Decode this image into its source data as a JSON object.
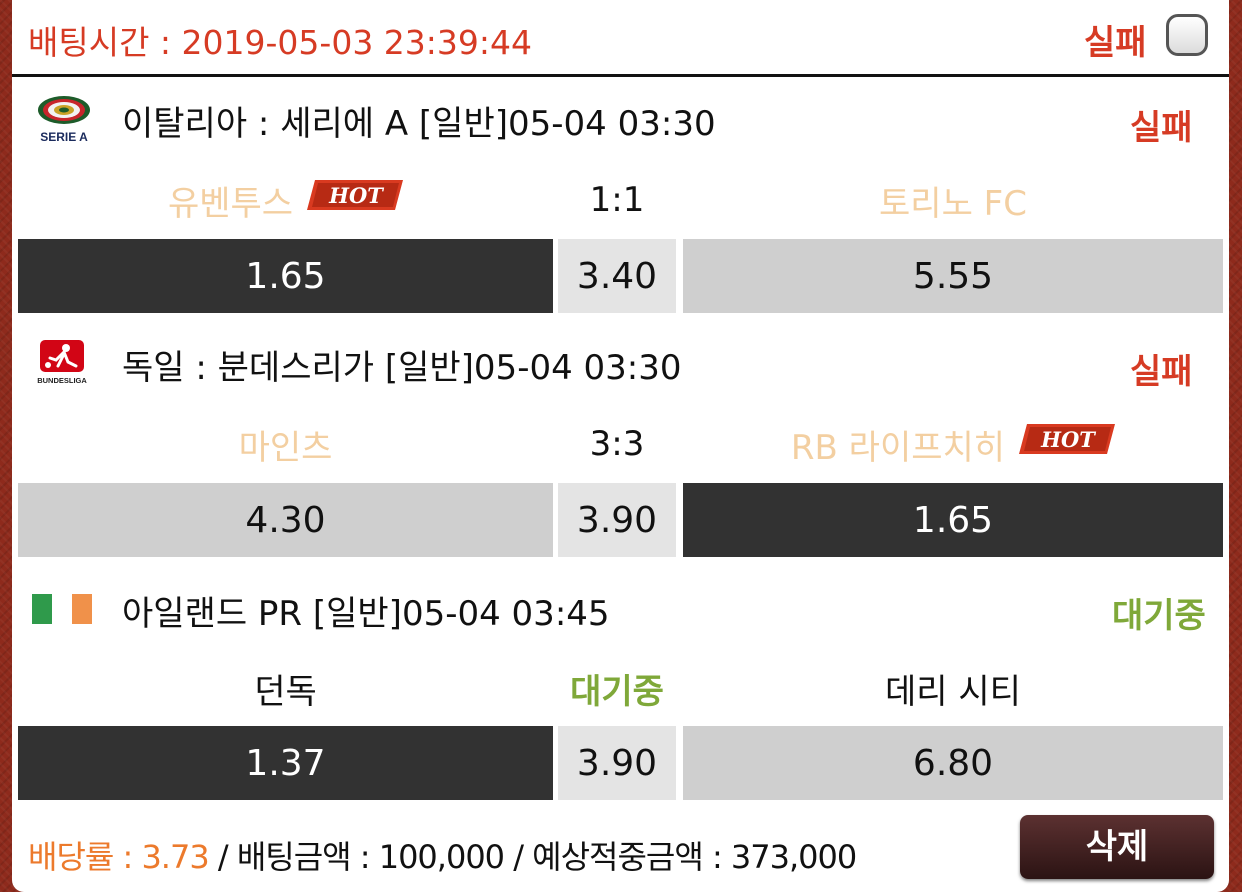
{
  "header": {
    "bet_time": "배팅시간 : 2019-05-03 23:39:44",
    "status": "실패"
  },
  "hot_badge": "HOT",
  "colors": {
    "accent_red": "#d63b24",
    "pending_green": "#7fa839",
    "rate_orange": "#ec7a2c",
    "selected_odd": "#323232",
    "unselected_odd": "#cfcfcf"
  },
  "matches": [
    {
      "league_icon": "serie-a-logo",
      "league_logo_text": "SERIE A",
      "title": "이탈리아 : 세리에 A [일반]05-04 03:30",
      "status": "실패",
      "home": "유벤투스",
      "score": "1:1",
      "away": "토리노 FC",
      "odds": {
        "home": "1.65",
        "draw": "3.40",
        "away": "5.55"
      },
      "selected": "home",
      "hot": "home"
    },
    {
      "league_icon": "bundesliga-logo",
      "league_logo_text": "BUNDESLIGA",
      "title": "독일 : 분데스리가 [일반]05-04 03:30",
      "status": "실패",
      "home": "마인츠",
      "score": "3:3",
      "away": "RB 라이프치히",
      "odds": {
        "home": "4.30",
        "draw": "3.90",
        "away": "1.65"
      },
      "selected": "away",
      "hot": "away"
    },
    {
      "league_icon": "ireland-flag-icon",
      "title": "아일랜드 PR [일반]05-04 03:45",
      "status": "대기중",
      "home": "던독",
      "score": "대기중",
      "away": "데리 시티",
      "odds": {
        "home": "1.37",
        "draw": "3.90",
        "away": "6.80"
      },
      "selected": "home"
    }
  ],
  "footer": {
    "rate_label": "배당률 : 3.73",
    "amount_label": " / 배팅금액 : 100,000 / 예상적중금액 : 373,000",
    "delete_label": "삭제"
  }
}
